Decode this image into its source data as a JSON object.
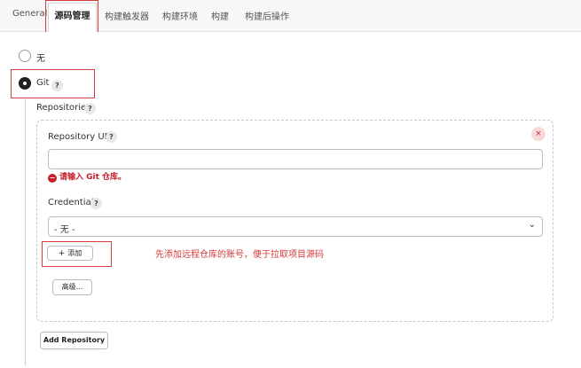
{
  "tabs": [
    "General",
    "源码管理",
    "构建触发器",
    "构建环境",
    "构建",
    "构建后操作"
  ],
  "scm": {
    "option_none": "无",
    "option_git": "Git",
    "repositories_label": "Repositories",
    "repo_url_label": "Repository URL",
    "repo_url_value": "",
    "error_text": "请输入 Git 仓库。",
    "credentials_label": "Credentials",
    "credentials_selected": "- 无 -",
    "add_button": "添加",
    "advanced_button": "高级...",
    "add_repository_button": "Add Repository"
  },
  "annotation": "先添加远程仓库的账号，便于拉取项目源码",
  "colors": {
    "highlight": "#d63b3b",
    "error": "#c4202b",
    "note": "#d53a3a"
  },
  "icons": {
    "help": "?",
    "delete": "×",
    "error": "−",
    "plus": "+",
    "chevron": "⌄"
  }
}
